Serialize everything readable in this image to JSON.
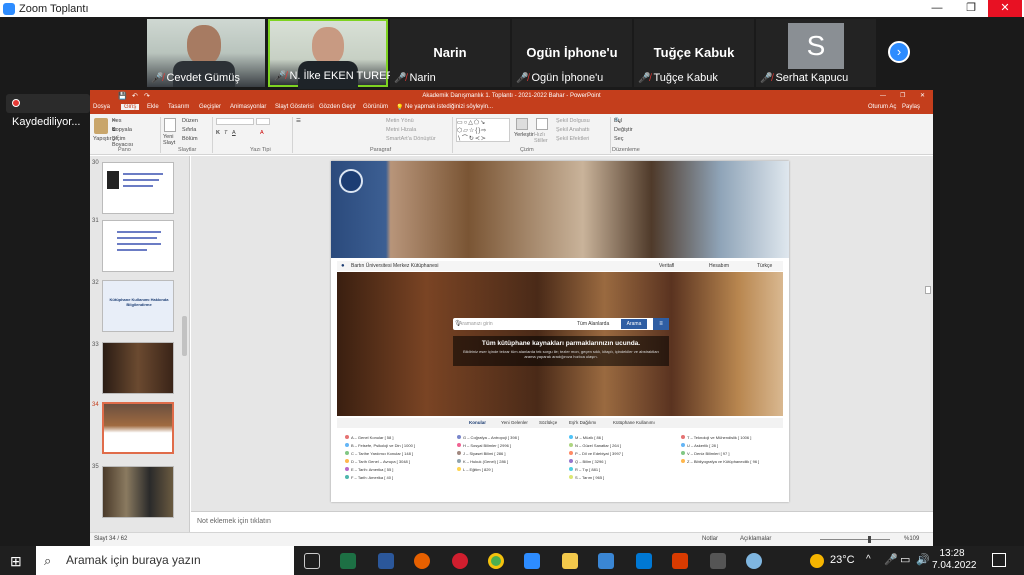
{
  "zoom": {
    "title": "Zoom Toplantı",
    "recording_label": "Kaydediliyor...",
    "participants": [
      {
        "name": "Cevdet Gümüş",
        "muted": true,
        "video": true
      },
      {
        "name": "N. İlke EKEN TURER",
        "muted": true,
        "video": true,
        "active": true
      },
      {
        "name": "Narin",
        "muted": true,
        "video": false
      },
      {
        "name": "Ogün İphone'u",
        "muted": true,
        "video": false
      },
      {
        "name": "Tuğçe Kabuk",
        "muted": true,
        "video": false
      },
      {
        "name": "Serhat Kapucu",
        "muted": true,
        "video": false,
        "initial": "S"
      }
    ]
  },
  "powerpoint": {
    "title": "Akademik Danışmanlık 1. Toplantı - 2021-2022 Bahar - PowerPoint",
    "signin": "Oturum Aç",
    "share": "Paylaş",
    "tabs": [
      "Dosya",
      "Giriş",
      "Ekle",
      "Tasarım",
      "Geçişler",
      "Animasyonlar",
      "Slayt Gösterisi",
      "Gözden Geçir",
      "Görünüm"
    ],
    "tell_me": "Ne yapmak istediğinizi söyleyin...",
    "ribbon": {
      "paste": "Yapıştır",
      "cut": "Kes",
      "copy": "Kopyala",
      "format_painter": "Biçim Boyacısı",
      "clipboard_group": "Pano",
      "new_slide": "Yeni Slayt",
      "layout": "Düzen",
      "reset": "Sıfırla",
      "section": "Bölüm",
      "slides_group": "Slaytlar",
      "font_group": "Yazı Tipi",
      "text_direction": "Metin Yönü",
      "align_text": "Metni Hizala",
      "smartart": "SmartArt'a Dönüştür",
      "paragraph_group": "Paragraf",
      "arrange": "Yerleştir",
      "quick_styles": "Hızlı Stiller",
      "shape_fill": "Şekil Dolgusu",
      "shape_outline": "Şekil Anahattı",
      "shape_effects": "Şekil Efektleri",
      "drawing_group": "Çizim",
      "find": "Bul",
      "replace": "Değiştir",
      "select": "Seç",
      "editing_group": "Düzenleme"
    },
    "thumb_numbers": [
      "30",
      "31",
      "32",
      "33",
      "34",
      "35"
    ],
    "slide32_title": "Kütüphane Kullanımı Hakkında Bilgilendirme",
    "notes_placeholder": "Not eklemek için tıklatın",
    "status": {
      "slide": "Slayt 34 / 62",
      "notes": "Notlar",
      "comments": "Açıklamalar",
      "zoom": "%109"
    },
    "slide": {
      "library_name": "Bartın Üniversitesi Merkez Kütüphanesi",
      "top_links": [
        "Veritafl",
        "Hesabım",
        "Türkçe"
      ],
      "search_placeholder": "Aramanızı girin",
      "search_scope": "Tüm Alanlarda",
      "search_button": "Arama",
      "tagline": "Tüm kütüphane kaynakları parmaklarınızın ucunda.",
      "tagline_sub": "Bildiriniz eser içinde tekrar tüm alanlarda tek sorgu ile; tezler mon, geçen sıklı, kitaplı, içindekiler ve abstraktları arama yaparak aradığınıza hızlıca ulaşın.",
      "tabs": [
        "Konular",
        "Yeni Gelenler",
        "Sözlükçe",
        "Eşi'k Dağılımı",
        "Kütüphane Kullanımı"
      ],
      "categories": [
        {
          "label": "A – Genel Konular [ 58 ]",
          "color": "#e57373"
        },
        {
          "label": "B – Felsefe, Psikoloji ve Din [ 1000 ]",
          "color": "#64b5f6"
        },
        {
          "label": "C – Tarihe Yardımcı Konular [ 148 ]",
          "color": "#81c784"
        },
        {
          "label": "D – Tarih Genel – Avrupa [ 3048 ]",
          "color": "#ffb74d"
        },
        {
          "label": "E – Tarih: Amerika [ 55 ]",
          "color": "#ba68c8"
        },
        {
          "label": "F – Tarih: Amerika [ 40 ]",
          "color": "#4db6ac"
        },
        {
          "label": "G – Coğrafya – Antropoji [ 398 ]",
          "color": "#7986cb"
        },
        {
          "label": "H – Sosyal Bilimler [ 2996 ]",
          "color": "#f06292"
        },
        {
          "label": "J – Siyaset Bilimi [ 286 ]",
          "color": "#a1887f"
        },
        {
          "label": "K – Hukuk (Genel) [ 286 ]",
          "color": "#90a4ae"
        },
        {
          "label": "L – Eğitim [ 829 ]",
          "color": "#ffd54f"
        },
        {
          "label": "M – Müzik [ 86 ]",
          "color": "#4fc3f7"
        },
        {
          "label": "N – Güzel Sanatlar [ 264 ]",
          "color": "#aed581"
        },
        {
          "label": "P – Dil ve Edebiyat [ 3997 ]",
          "color": "#ff8a65"
        },
        {
          "label": "Q – Bilim [ 3296 ]",
          "color": "#9575cd"
        },
        {
          "label": "R – Tıp [ 881 ]",
          "color": "#4dd0e1"
        },
        {
          "label": "S – Tarım [ 965 ]",
          "color": "#dce775"
        },
        {
          "label": "T – Teknoloji ve Mühendislik [ 1006 ]",
          "color": "#e57373"
        },
        {
          "label": "U – Askerlik [ 28 ]",
          "color": "#64b5f6"
        },
        {
          "label": "V – Deniz Bilimleri [ 97 ]",
          "color": "#81c784"
        },
        {
          "label": "Z – Bibliyografya ve Kütüphanecilik [ 96 ]",
          "color": "#ffb74d"
        }
      ]
    }
  },
  "taskbar": {
    "search_placeholder": "Aramak için buraya yazın",
    "temperature": "23°C",
    "time": "13:28",
    "date": "7.04.2022"
  }
}
